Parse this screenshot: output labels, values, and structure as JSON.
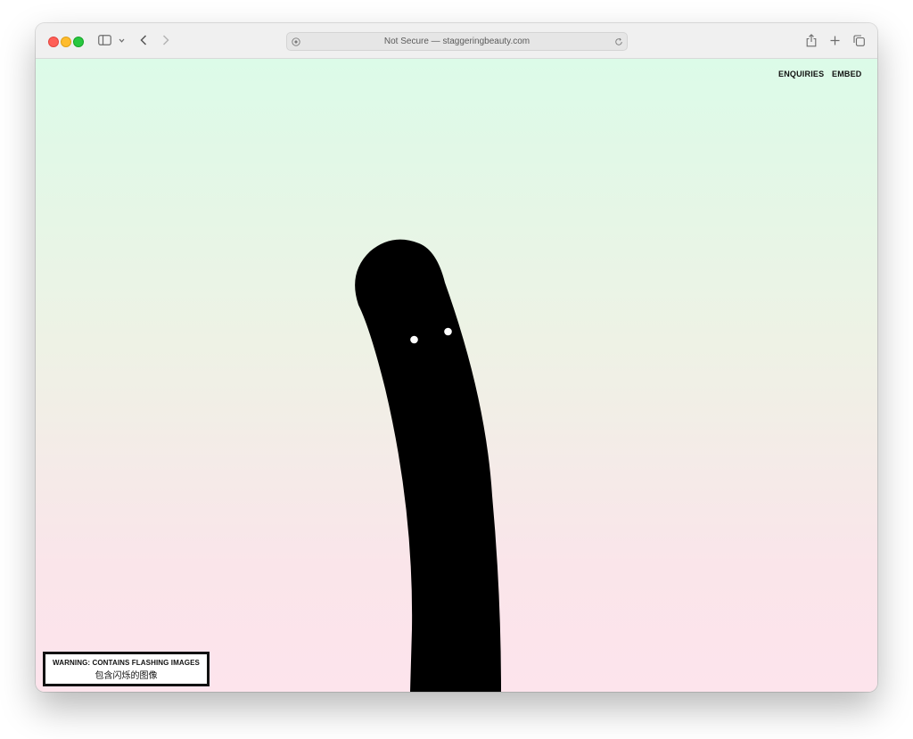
{
  "browser": {
    "address": "Not Secure — staggeringbeauty.com",
    "icons": {
      "sidebar": "sidebar-icon",
      "chevron": "chevron-down-icon",
      "back": "back-arrow-icon",
      "forward": "forward-arrow-icon",
      "site_info": "site-info-icon",
      "reload": "reload-icon",
      "share": "share-icon",
      "new_tab": "plus-icon",
      "tab_overview": "tab-overview-icon"
    }
  },
  "page": {
    "nav": {
      "enquiries": "ENQUIRIES",
      "embed": "EMBED"
    },
    "warning": {
      "english": "WARNING: CONTAINS FLASHING IMAGES",
      "chinese": "包含闪烁的图像"
    },
    "colors": {
      "gradient_top": "#dcfbe8",
      "gradient_bottom": "#fde4ec",
      "creature": "#000000",
      "eyes": "#ffffff"
    }
  }
}
